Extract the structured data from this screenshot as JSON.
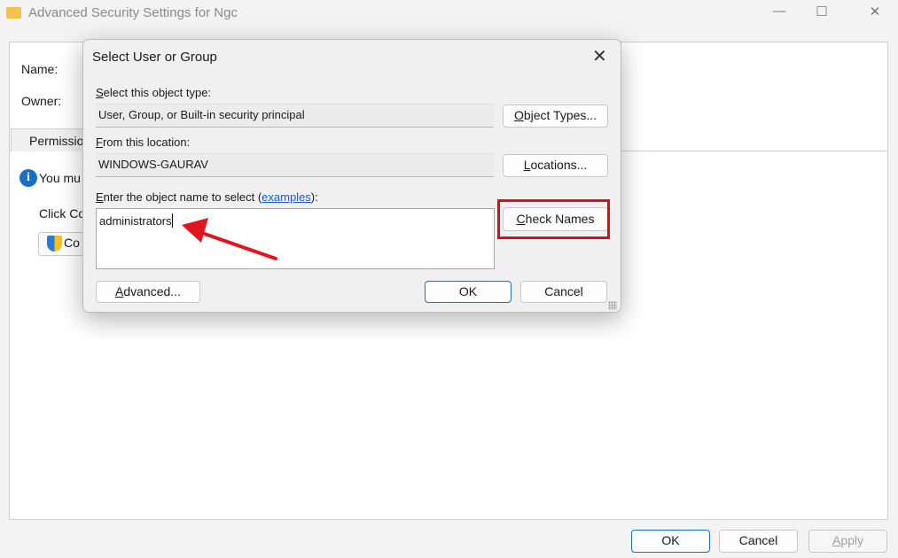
{
  "window": {
    "title": "Advanced Security Settings for Ngc",
    "minimize": "—",
    "maximize": "☐",
    "close": "✕",
    "name_label": "Name:",
    "owner_label": "Owner:",
    "tab_permissions": "Permissions",
    "info_text": "You mu",
    "click_text": "Click Co",
    "copy_button": "Co",
    "ok": "OK",
    "cancel": "Cancel",
    "apply": "Apply"
  },
  "dialog": {
    "title": "Select User or Group",
    "close": "✕",
    "object_type_label": "Select this object type:",
    "object_type_value": "User, Group, or Built-in security principal",
    "object_types_button": "Object Types...",
    "location_label": "From this location:",
    "location_value": "WINDOWS-GAURAV",
    "locations_button": "Locations...",
    "enter_label_pre": "Enter the object name to select (",
    "examples_link": "examples",
    "enter_label_post": "):",
    "object_name_value": "administrators",
    "check_names_button": "Check Names",
    "advanced_button": "Advanced...",
    "ok": "OK",
    "cancel": "Cancel"
  },
  "colors": {
    "highlight": "#d0121b",
    "arrow": "#e0161e",
    "link": "#1660c8"
  }
}
